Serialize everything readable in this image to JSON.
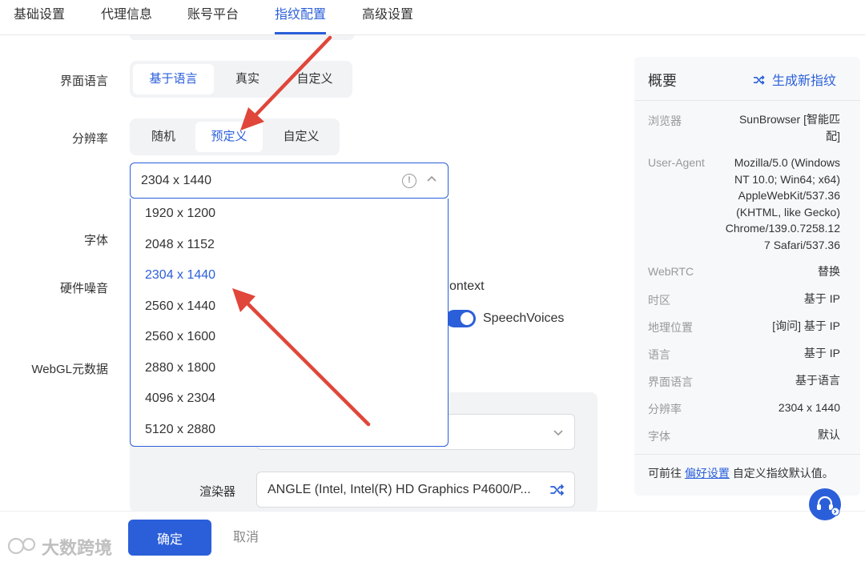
{
  "tabs": [
    {
      "label": "基础设置"
    },
    {
      "label": "代理信息"
    },
    {
      "label": "账号平台"
    },
    {
      "label": "指纹配置",
      "active": true
    },
    {
      "label": "高级设置"
    }
  ],
  "form": {
    "ui_language": {
      "label": "界面语言",
      "options": [
        "基于语言",
        "真实",
        "自定义"
      ],
      "selected": "基于语言"
    },
    "resolution": {
      "label": "分辨率",
      "options": [
        "随机",
        "预定义",
        "自定义"
      ],
      "selected": "预定义",
      "current_value": "2304 x 1440",
      "dropdown_options": [
        "1920 x 1200",
        "2048 x 1152",
        "2304 x 1440",
        "2560 x 1440",
        "2560 x 1600",
        "2880 x 1800",
        "4096 x 2304",
        "5120 x 2880"
      ],
      "dropdown_selected": "2304 x 1440"
    },
    "font": {
      "label": "字体"
    },
    "hardware_noise": {
      "label": "硬件噪音",
      "partial_option_1": "ontext",
      "partial_option_2": "SpeechVoices"
    },
    "webgl": {
      "label": "WebGL元数据",
      "renderer_label": "渲染器",
      "renderer_value": "ANGLE (Intel, Intel(R) HD Graphics P4600/P..."
    }
  },
  "summary": {
    "title": "概要",
    "generate_label": "生成新指纹",
    "rows": [
      {
        "label": "浏览器",
        "value_lines": [
          "SunBrowser [智能匹",
          "配]"
        ]
      },
      {
        "label": "User-Agent",
        "value_lines": [
          "Mozilla/5.0 (Windows",
          "NT 10.0; Win64; x64)",
          "AppleWebKit/537.36",
          "(KHTML, like Gecko)",
          "Chrome/139.0.7258.12",
          "7 Safari/537.36"
        ]
      },
      {
        "label": "WebRTC",
        "value_lines": [
          "替换"
        ]
      },
      {
        "label": "时区",
        "value_lines": [
          "基于 IP"
        ]
      },
      {
        "label": "地理位置",
        "value_lines": [
          "[询问] 基于 IP"
        ]
      },
      {
        "label": "语言",
        "value_lines": [
          "基于 IP"
        ]
      },
      {
        "label": "界面语言",
        "value_lines": [
          "基于语言"
        ]
      },
      {
        "label": "分辨率",
        "value_lines": [
          "2304 x 1440"
        ]
      },
      {
        "label": "字体",
        "value_lines": [
          "默认"
        ]
      }
    ],
    "footer_prefix": "可前往",
    "footer_link": "偏好设置",
    "footer_suffix": "自定义指纹默认值。"
  },
  "actions": {
    "ok_label": "确定",
    "cancel_label": "取消"
  },
  "watermark": "大数跨境",
  "colors": {
    "accent": "#2b5fd9",
    "annotation_arrow": "#e0463a"
  }
}
